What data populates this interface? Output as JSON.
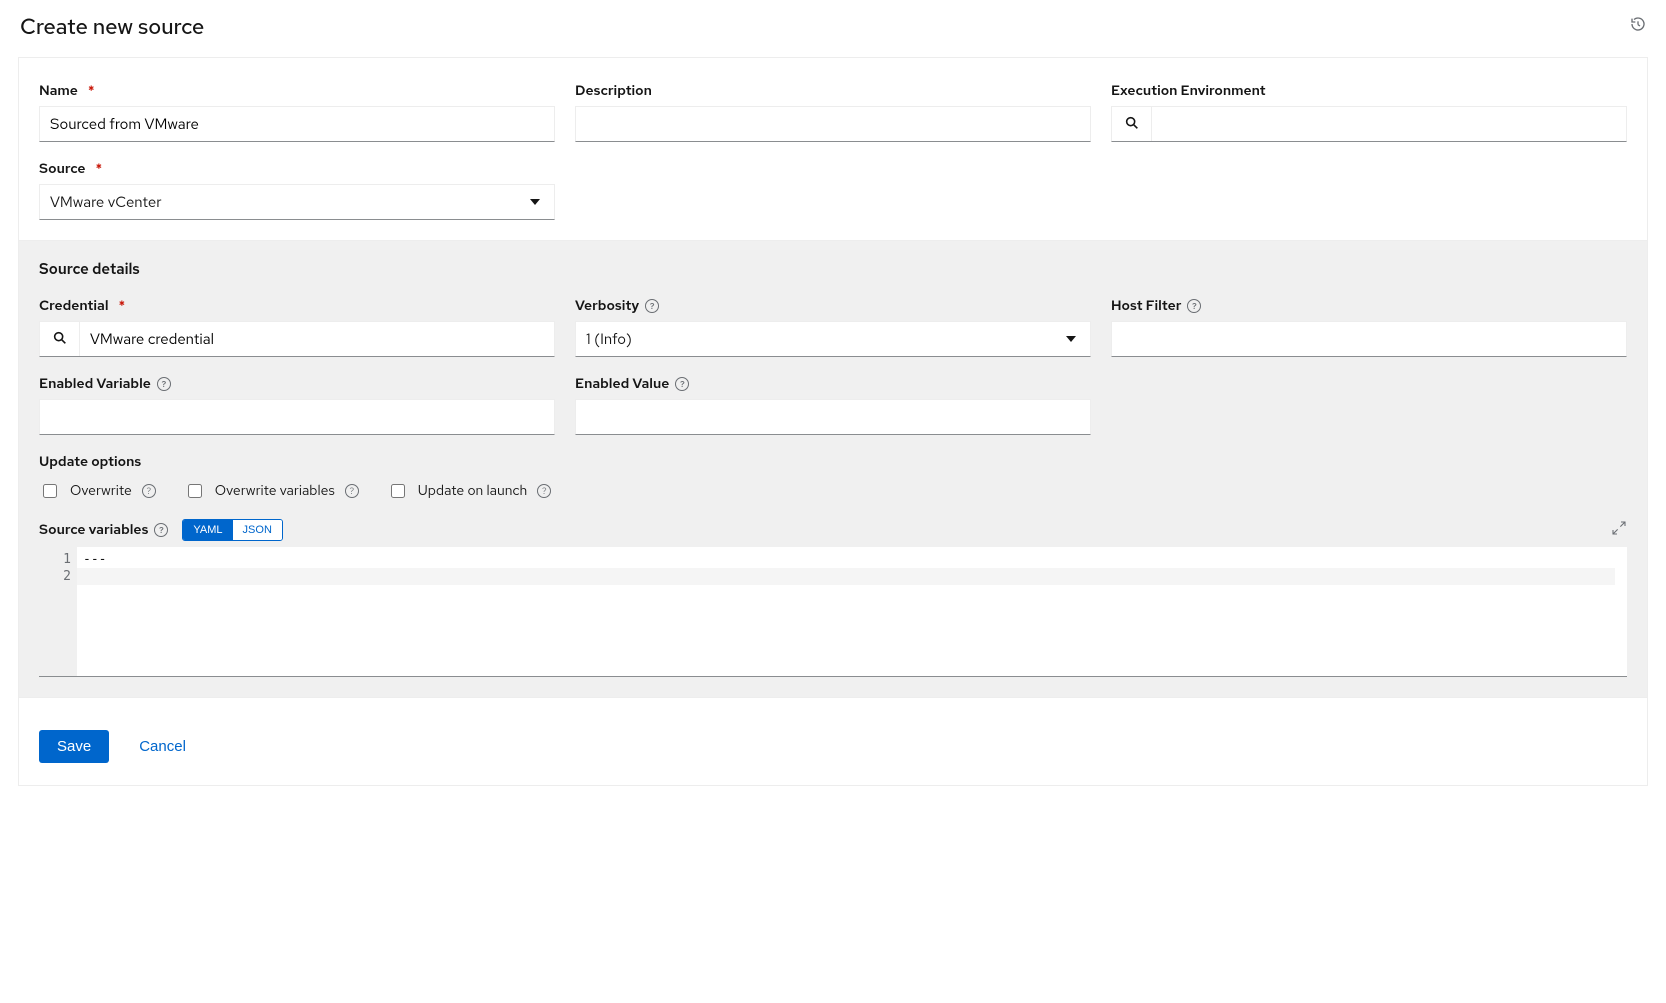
{
  "page": {
    "title": "Create new source"
  },
  "top": {
    "fields": {
      "name": {
        "label": "Name",
        "value": "Sourced from VMware",
        "required": true
      },
      "description": {
        "label": "Description",
        "value": ""
      },
      "exec_env": {
        "label": "Execution Environment",
        "value": ""
      },
      "source": {
        "label": "Source",
        "value": "VMware vCenter",
        "required": true
      }
    }
  },
  "details": {
    "title": "Source details",
    "credential": {
      "label": "Credential",
      "value": "VMware credential",
      "required": true
    },
    "verbosity": {
      "label": "Verbosity",
      "value": "1 (Info)"
    },
    "host_filter": {
      "label": "Host Filter",
      "value": ""
    },
    "enabled_var": {
      "label": "Enabled Variable",
      "value": ""
    },
    "enabled_val": {
      "label": "Enabled Value",
      "value": ""
    },
    "update_options": {
      "label": "Update options",
      "items": [
        {
          "label": "Overwrite",
          "checked": false
        },
        {
          "label": "Overwrite variables",
          "checked": false
        },
        {
          "label": "Update on launch",
          "checked": false
        }
      ]
    },
    "source_vars": {
      "label": "Source variables",
      "modes": [
        "YAML",
        "JSON"
      ],
      "active_mode": "YAML",
      "lines": [
        "---",
        ""
      ]
    }
  },
  "footer": {
    "save": "Save",
    "cancel": "Cancel"
  }
}
